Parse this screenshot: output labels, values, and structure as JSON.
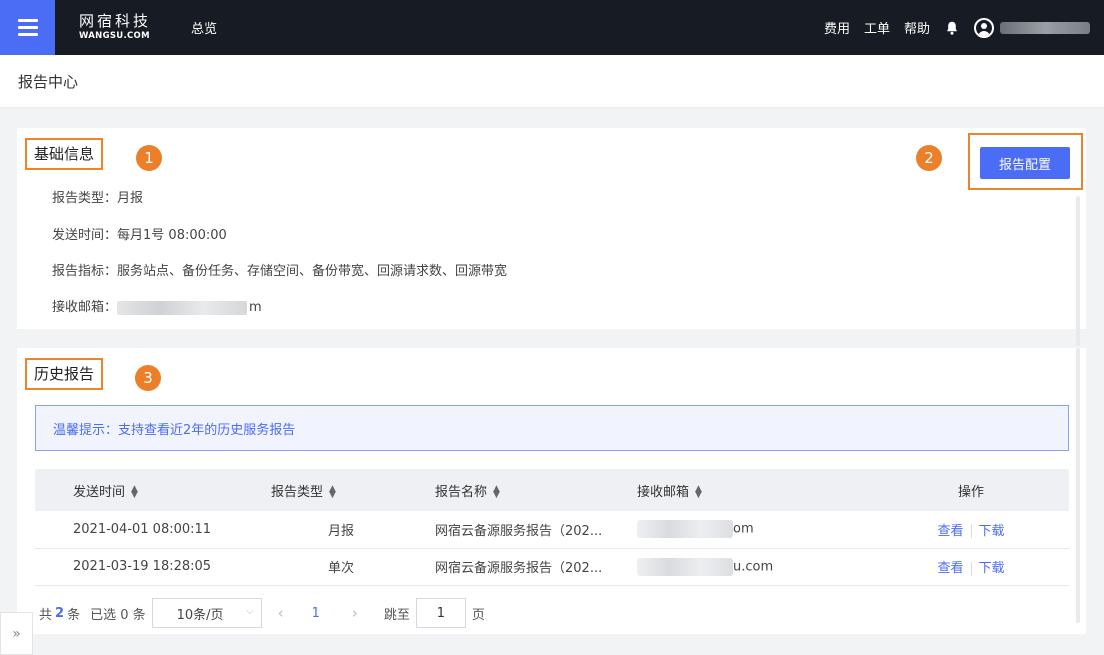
{
  "topbar": {
    "logo_cn": "网宿科技",
    "logo_en": "WANGSU.COM",
    "nav_overview": "总览",
    "links": {
      "fees": "费用",
      "tickets": "工单",
      "help": "帮助"
    }
  },
  "page": {
    "title": "报告中心"
  },
  "basic_info": {
    "title": "基础信息",
    "badge": "1",
    "config_badge": "2",
    "config_button": "报告配置",
    "rows": {
      "type_label": "报告类型：",
      "type_value": "月报",
      "time_label": "发送时间：",
      "time_value": "每月1号 08:00:00",
      "metrics_label": "报告指标：",
      "metrics_value": "服务站点、备份任务、存储空间、备份带宽、回源请求数、回源带宽",
      "email_label": "接收邮箱：",
      "email_suffix": "m"
    }
  },
  "history": {
    "title": "历史报告",
    "badge": "3",
    "tip": "温馨提示：支持查看近2年的历史服务报告",
    "columns": [
      "发送时间",
      "报告类型",
      "报告名称",
      "接收邮箱",
      "操作"
    ],
    "rows": [
      {
        "time": "2021-04-01 08:00:11",
        "type": "月报",
        "name": "网宿云备源服务报告（202...",
        "email_suffix": "om",
        "view": "查看",
        "download": "下载"
      },
      {
        "time": "2021-03-19 18:28:05",
        "type": "单次",
        "name": "网宿云备源服务报告（202...",
        "email_suffix": "u.com",
        "view": "查看",
        "download": "下载"
      }
    ],
    "pager": {
      "total_prefix": "共",
      "total": "2",
      "total_suffix": "条",
      "selected": "已选 0 条",
      "page_size": "10条/页",
      "prev": "‹",
      "current": "1",
      "next": "›",
      "jump_label": "跳至",
      "jump_value": "1",
      "page_suffix": "页"
    }
  },
  "side_toggle": "»",
  "colors": {
    "primary": "#4b6cf5",
    "highlight": "#e8862f",
    "topbar": "#161b24"
  }
}
